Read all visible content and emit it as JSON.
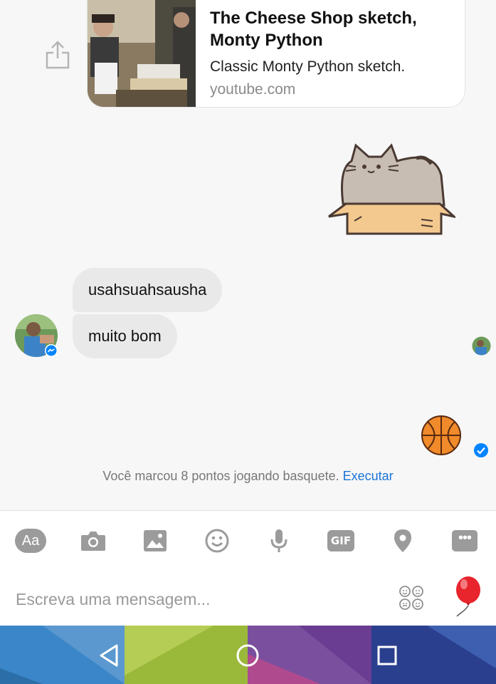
{
  "link_preview": {
    "title": "The Cheese Shop sketch, Monty Python",
    "description": "Classic Monty Python sketch.",
    "domain": "youtube.com"
  },
  "messages": [
    {
      "text": "usahsuahsausha",
      "from": "contact"
    },
    {
      "text": "muito bom",
      "from": "contact"
    }
  ],
  "game_note": {
    "text": "Você marcou 8 pontos jogando basquete.",
    "action": "Executar"
  },
  "composer": {
    "placeholder": "Escreva uma mensagem...",
    "aa_label": "Aa",
    "gif_label": "GIF",
    "tools": [
      "text-style",
      "camera",
      "gallery",
      "emoji",
      "microphone",
      "gif",
      "location",
      "more"
    ]
  },
  "colors": {
    "accent": "#0084ff",
    "link_blue": "#1a73d9",
    "bubble": "#e9e9e9"
  }
}
